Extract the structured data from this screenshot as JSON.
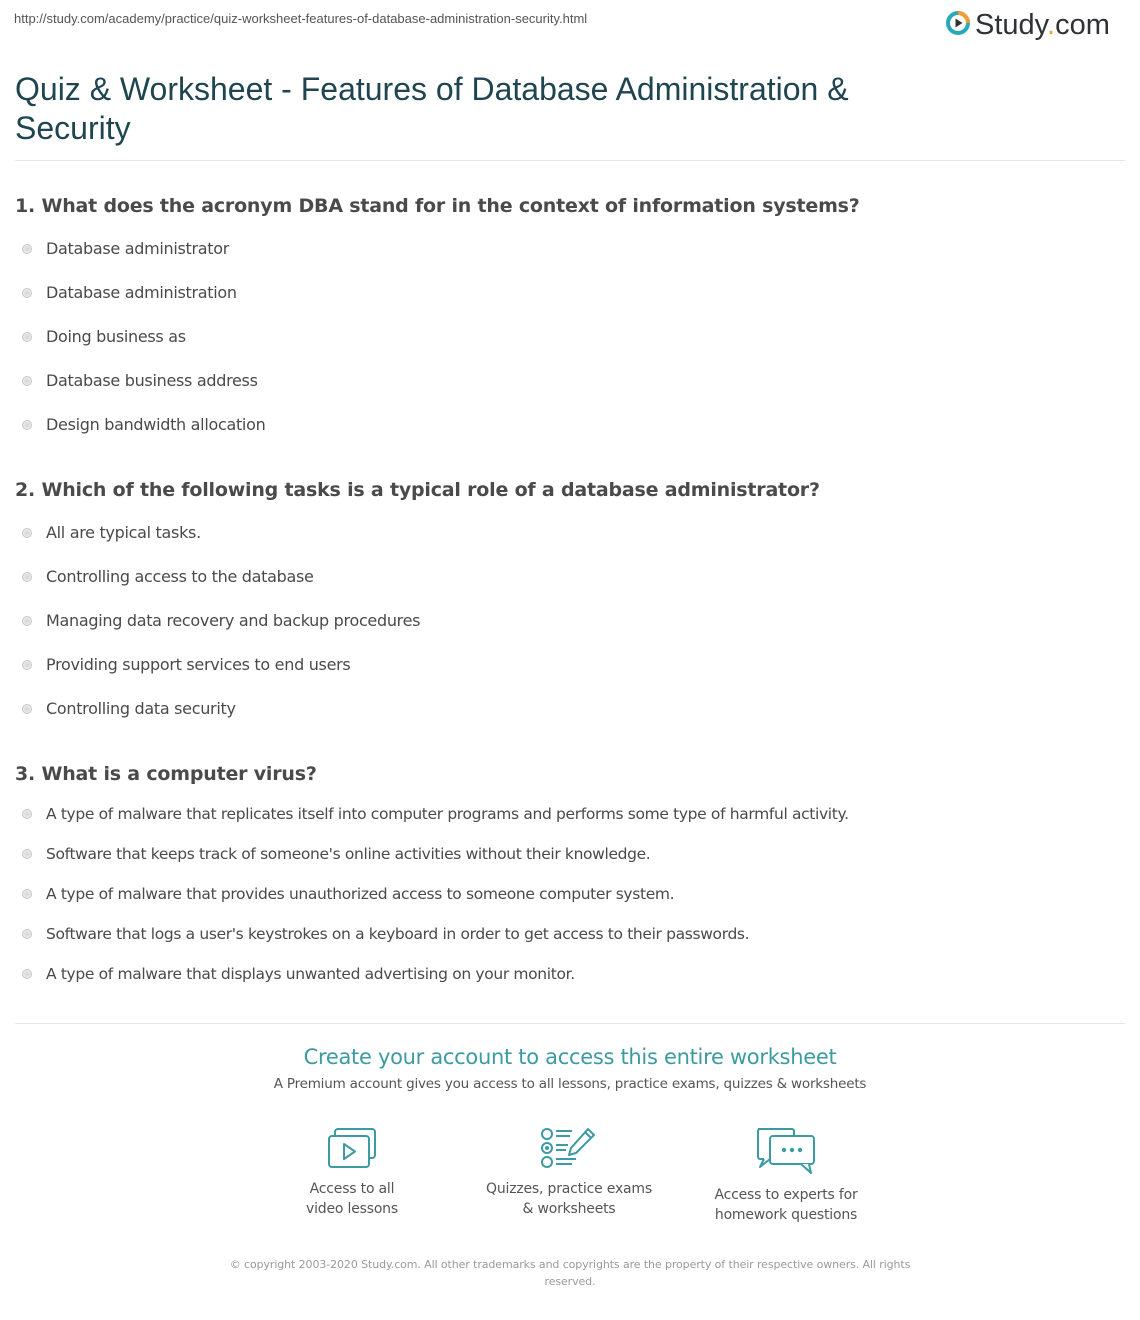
{
  "page": {
    "url": "http://study.com/academy/practice/quiz-worksheet-features-of-database-administration-security.html",
    "logo": {
      "name": "Study",
      "dot": ".",
      "tld": "com",
      "icon": "play-circle-logo-icon",
      "colors": {
        "ring_teal": "#2aa8b8",
        "ring_orange": "#f39c34",
        "text": "#2f3134"
      }
    },
    "title": "Quiz & Worksheet - Features of Database Administration & Security"
  },
  "questions": [
    {
      "number": "1.",
      "text": "1. What does the acronym DBA stand for in the context of information systems?",
      "options": [
        {
          "label": "Database administrator"
        },
        {
          "label": "Database administration"
        },
        {
          "label": "Doing business as"
        },
        {
          "label": "Database business address"
        },
        {
          "label": "Design bandwidth allocation"
        }
      ]
    },
    {
      "number": "2.",
      "text": "2. Which of the following tasks is a typical role of a database administrator?",
      "options": [
        {
          "label": "All are typical tasks."
        },
        {
          "label": "Controlling access to the database"
        },
        {
          "label": "Managing data recovery and backup procedures"
        },
        {
          "label": "Providing support services to end users"
        },
        {
          "label": "Controlling data security"
        }
      ]
    },
    {
      "number": "3.",
      "text": "3. What is a computer virus?",
      "options": [
        {
          "label": "A type of malware that replicates itself into computer programs and performs some type of harmful activity."
        },
        {
          "label": "Software that keeps track of someone's online activities without their knowledge."
        },
        {
          "label": "A type of malware that provides unauthorized access to someone computer system."
        },
        {
          "label": "Software that logs a user's keystrokes on a keyboard in order to get access to their passwords."
        },
        {
          "label": "A type of malware that displays unwanted advertising on your monitor."
        }
      ]
    }
  ],
  "cta": {
    "title": "Create your account to access this entire worksheet",
    "subtitle": "A Premium account gives you access to all lessons, practice exams, quizzes & worksheets",
    "accent_color": "#3c9aa2",
    "features": [
      {
        "icon": "video-lessons-icon",
        "label": "Access to all\nvideo lessons"
      },
      {
        "icon": "quiz-checklist-pencil-icon",
        "label": "Quizzes, practice exams\n& worksheets"
      },
      {
        "icon": "chat-bubbles-icon",
        "label": "Access to experts for\nhomework questions"
      }
    ]
  },
  "footer": {
    "copyright": "© copyright 2003-2020 Study.com. All other trademarks and copyrights are the property of their respective owners. All rights reserved."
  }
}
